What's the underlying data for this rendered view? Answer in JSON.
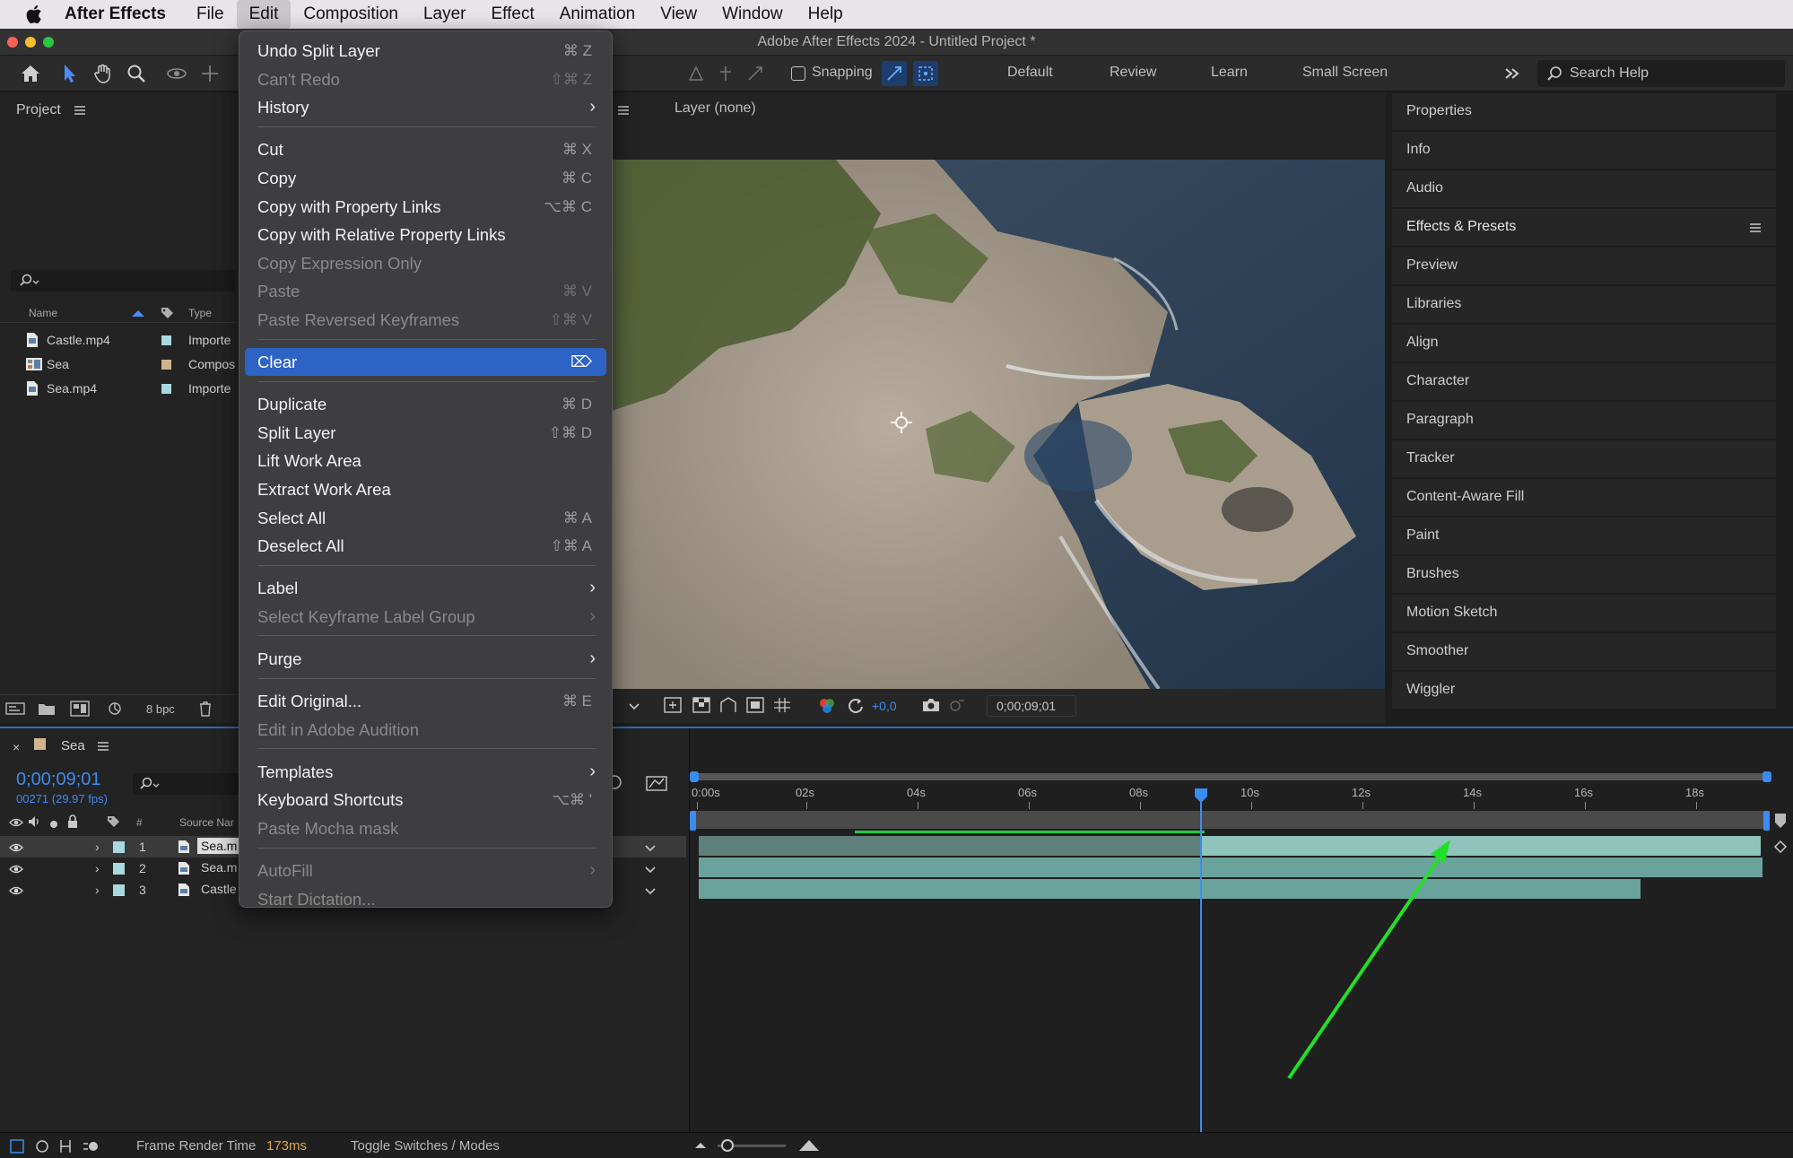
{
  "menubar": {
    "app_name": "After Effects",
    "items": [
      "File",
      "Edit",
      "Composition",
      "Layer",
      "Effect",
      "Animation",
      "View",
      "Window",
      "Help"
    ],
    "active": "Edit"
  },
  "window": {
    "title": "Adobe After Effects 2024 - Untitled Project *"
  },
  "toolbar": {
    "snapping_label": "Snapping",
    "workspaces": [
      "Default",
      "Review",
      "Learn",
      "Small Screen"
    ],
    "search_placeholder": "Search Help"
  },
  "project": {
    "title": "Project",
    "col_name": "Name",
    "col_type": "Type",
    "items": [
      {
        "name": "Castle.mp4",
        "type": "Importe",
        "color": "#a8d8e0"
      },
      {
        "name": "Sea",
        "type": "Compos",
        "color": "#d0b48c"
      },
      {
        "name": "Sea.mp4",
        "type": "Importe",
        "color": "#a8d8e0"
      }
    ],
    "bpc": "8 bpc"
  },
  "viewer": {
    "layer_label": "Layer (none)",
    "exposure": "+0,0",
    "timecode": "0;00;09;01"
  },
  "right_panel": {
    "items": [
      "Properties",
      "Info",
      "Audio",
      "Effects & Presets",
      "Preview",
      "Libraries",
      "Align",
      "Character",
      "Paragraph",
      "Tracker",
      "Content-Aware Fill",
      "Paint",
      "Brushes",
      "Motion Sketch",
      "Smoother",
      "Wiggler"
    ]
  },
  "timeline": {
    "comp_name": "Sea",
    "timecode": "0;00;09;01",
    "fps_line": "00271 (29.97 fps)",
    "col_num": "#",
    "col_source": "Source Nar",
    "ruler": [
      "0:00s",
      "02s",
      "04s",
      "06s",
      "08s",
      "10s",
      "12s",
      "14s",
      "16s",
      "18s"
    ],
    "layers": [
      {
        "num": "1",
        "name": "Sea.m"
      },
      {
        "num": "2",
        "name": "Sea.m"
      },
      {
        "num": "3",
        "name": "Castle"
      }
    ]
  },
  "status": {
    "frame_render_label": "Frame Render Time",
    "frame_render_value": "173ms",
    "toggle_label": "Toggle Switches / Modes"
  },
  "edit_menu": {
    "items": [
      {
        "label": "Undo Split Layer",
        "shortcut": "⌘ Z",
        "disabled": false
      },
      {
        "label": "Can't Redo",
        "shortcut": "⇧⌘ Z",
        "disabled": true
      },
      {
        "label": "History",
        "submenu": true,
        "disabled": false
      },
      {
        "label": "Cut",
        "shortcut": "⌘ X",
        "disabled": false
      },
      {
        "label": "Copy",
        "shortcut": "⌘ C",
        "disabled": false
      },
      {
        "label": "Copy with Property Links",
        "shortcut": "⌥⌘ C",
        "disabled": false
      },
      {
        "label": "Copy with Relative Property Links",
        "shortcut": "",
        "disabled": false
      },
      {
        "label": "Copy Expression Only",
        "shortcut": "",
        "disabled": true
      },
      {
        "label": "Paste",
        "shortcut": "⌘ V",
        "disabled": true
      },
      {
        "label": "Paste Reversed Keyframes",
        "shortcut": "⇧⌘ V",
        "disabled": true
      },
      {
        "label": "Clear",
        "shortcut": "⌦",
        "disabled": false,
        "highlighted": true
      },
      {
        "label": "Duplicate",
        "shortcut": "⌘ D",
        "disabled": false
      },
      {
        "label": "Split Layer",
        "shortcut": "⇧⌘ D",
        "disabled": false
      },
      {
        "label": "Lift Work Area",
        "shortcut": "",
        "disabled": false
      },
      {
        "label": "Extract Work Area",
        "shortcut": "",
        "disabled": false
      },
      {
        "label": "Select All",
        "shortcut": "⌘ A",
        "disabled": false
      },
      {
        "label": "Deselect All",
        "shortcut": "⇧⌘ A",
        "disabled": false
      },
      {
        "label": "Label",
        "submenu": true,
        "disabled": false
      },
      {
        "label": "Select Keyframe Label Group",
        "submenu": true,
        "disabled": true
      },
      {
        "label": "Purge",
        "submenu": true,
        "disabled": false
      },
      {
        "label": "Edit Original...",
        "shortcut": "⌘ E",
        "disabled": false
      },
      {
        "label": "Edit in Adobe Audition",
        "shortcut": "",
        "disabled": true
      },
      {
        "label": "Templates",
        "submenu": true,
        "disabled": false
      },
      {
        "label": "Keyboard Shortcuts",
        "shortcut": "⌥⌘ '",
        "disabled": false
      },
      {
        "label": "Paste Mocha mask",
        "shortcut": "",
        "disabled": true
      },
      {
        "label": "AutoFill",
        "submenu": true,
        "disabled": true
      },
      {
        "label": "Start Dictation...",
        "shortcut": "",
        "disabled": true
      }
    ]
  },
  "colors": {
    "accent_blue": "#2e63c6",
    "timecode_blue": "#3b8cf2",
    "annotation_arrow": "#22e02a",
    "clip_teal": "#6aa39b"
  }
}
